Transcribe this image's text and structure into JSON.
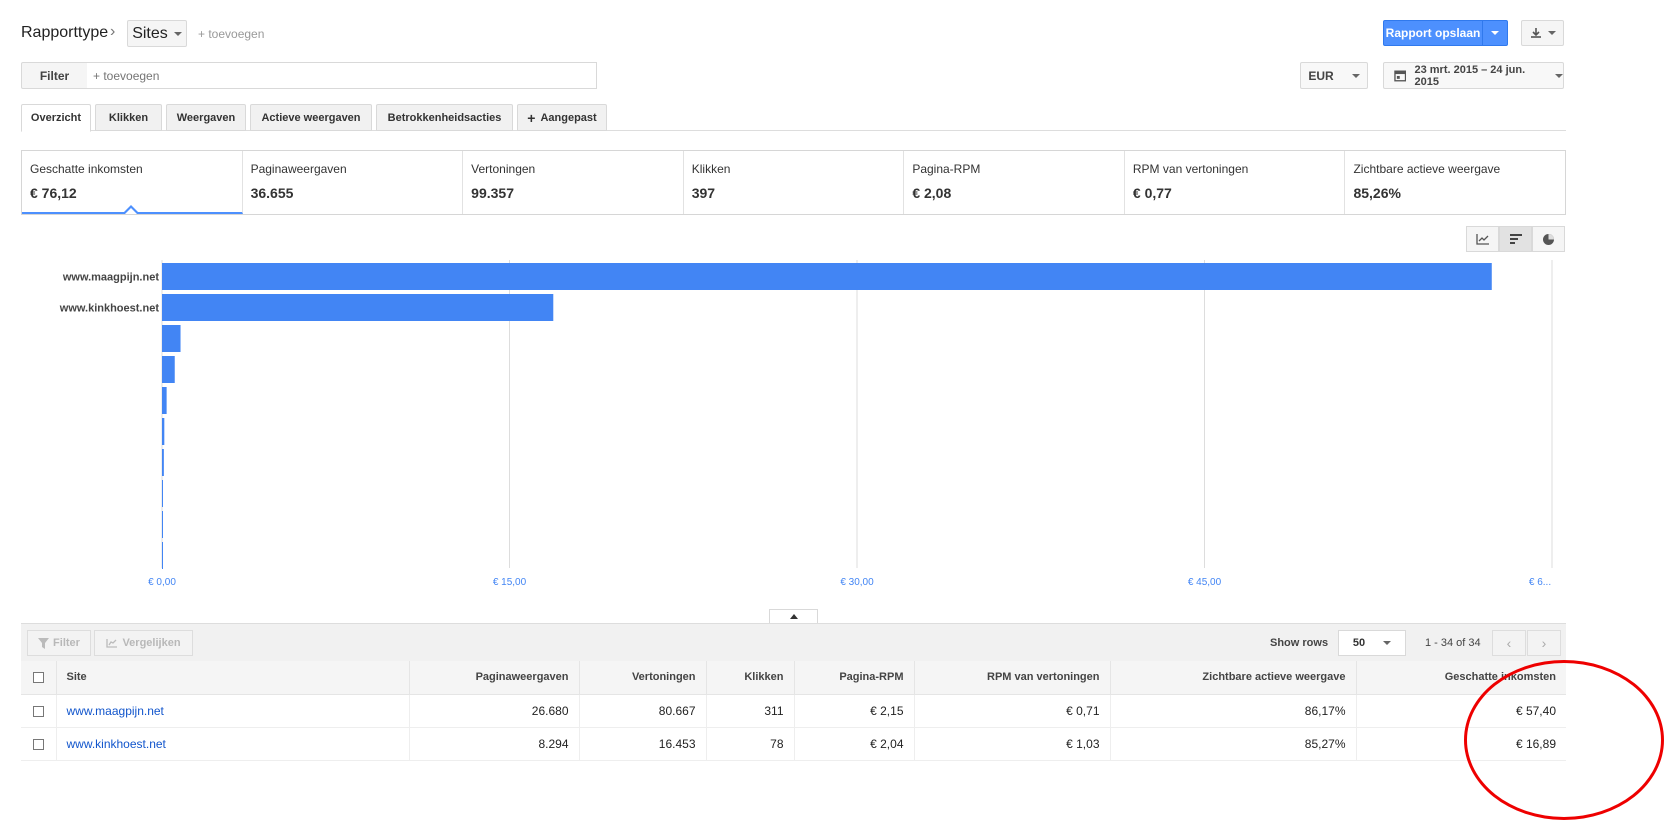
{
  "header": {
    "title": "Rapporttype",
    "dimension": "Sites",
    "add_dimension": "+ toevoegen",
    "save_label": "Rapport opslaan"
  },
  "filter": {
    "label": "Filter",
    "placeholder": "+ toevoegen"
  },
  "currency": "EUR",
  "date_range": "23 mrt. 2015 – 24 jun. 2015",
  "tabs": [
    {
      "label": "Overzicht",
      "active": true
    },
    {
      "label": "Klikken"
    },
    {
      "label": "Weergaven"
    },
    {
      "label": "Actieve weergaven"
    },
    {
      "label": "Betrokkenheidsacties"
    },
    {
      "label": "Aangepast"
    }
  ],
  "scorecards": [
    {
      "name": "Geschatte inkomsten",
      "value": "€ 76,12"
    },
    {
      "name": "Paginaweergaven",
      "value": "36.655"
    },
    {
      "name": "Vertoningen",
      "value": "99.357"
    },
    {
      "name": "Klikken",
      "value": "397"
    },
    {
      "name": "Pagina-RPM",
      "value": "€ 2,08"
    },
    {
      "name": "RPM van vertoningen",
      "value": "€ 0,77"
    },
    {
      "name": "Zichtbare actieve weergave",
      "value": "85,26%"
    }
  ],
  "chart_data": {
    "type": "bar",
    "orientation": "horizontal",
    "categories": [
      "www.maagpijn.net",
      "www.kinkhoest.net",
      "",
      "",
      "",
      "",
      "",
      "",
      "",
      ""
    ],
    "values": [
      57.4,
      16.89,
      0.8,
      0.55,
      0.2,
      0.1,
      0.08,
      0.0,
      0.0,
      0.0
    ],
    "xlim": [
      0,
      60
    ],
    "x_ticks": [
      "€ 0,00",
      "€ 15,00",
      "€ 30,00",
      "€ 45,00",
      "€ 6..."
    ],
    "grid": true,
    "color": "#4285f4"
  },
  "table_toolbar": {
    "filter_label": "Filter",
    "compare_label": "Vergelijken",
    "show_rows_label": "Show rows",
    "rows_value": "50",
    "page_info": "1 - 34 of 34"
  },
  "table": {
    "columns": [
      "Site",
      "Paginaweergaven",
      "Vertoningen",
      "Klikken",
      "Pagina-RPM",
      "RPM van vertoningen",
      "Zichtbare actieve weergave",
      "Geschatte inkomsten"
    ],
    "rows": [
      [
        "www.maagpijn.net",
        "26.680",
        "80.667",
        "311",
        "€ 2,15",
        "€ 0,71",
        "86,17%",
        "€ 57,40"
      ],
      [
        "www.kinkhoest.net",
        "8.294",
        "16.453",
        "78",
        "€ 2,04",
        "€ 1,03",
        "85,27%",
        "€ 16,89"
      ]
    ]
  }
}
